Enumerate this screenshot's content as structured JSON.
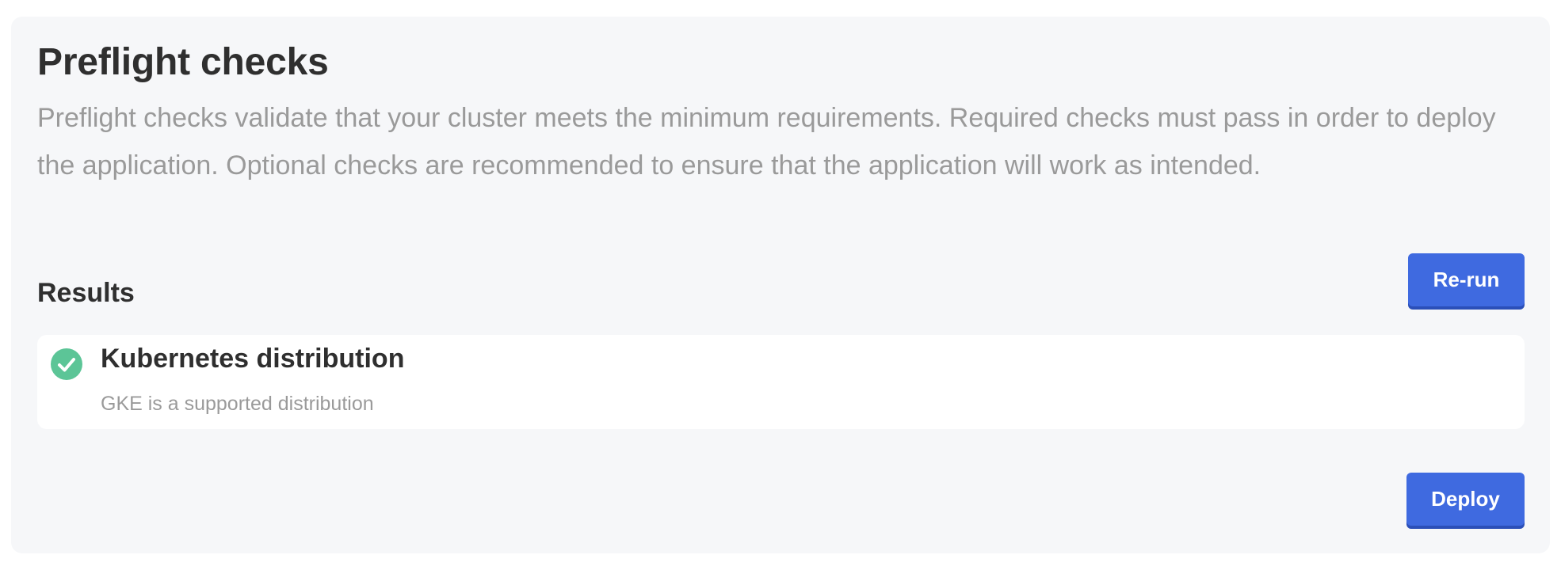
{
  "header": {
    "title": "Preflight checks",
    "description": "Preflight checks validate that your cluster meets the minimum requirements. Required checks must pass in order to deploy the application. Optional checks are recommended to ensure that the application will work as intended."
  },
  "results": {
    "title": "Results",
    "rerun_label": "Re-run",
    "items": [
      {
        "name": "Kubernetes distribution",
        "message": "GKE is a supported distribution",
        "status": "pass",
        "icon": "check-circle-icon",
        "status_color": "#5cc597"
      }
    ]
  },
  "footer": {
    "deploy_label": "Deploy"
  },
  "colors": {
    "accent": "#3f6ae0",
    "panel_background": "#f6f7f9",
    "text_primary": "#2f2f2f",
    "text_muted": "#9a9a9a"
  }
}
